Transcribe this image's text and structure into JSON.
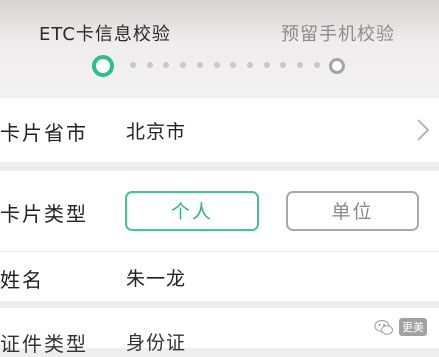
{
  "steps": {
    "step1_label": "ETC卡信息校验",
    "step2_label": "预留手机校验"
  },
  "form": {
    "province": {
      "label": "卡片省市",
      "value": "北京市"
    },
    "card_type": {
      "label": "卡片类型",
      "options": [
        "个人",
        "单位"
      ],
      "selected": "个人"
    },
    "name": {
      "label": "姓名",
      "value": "朱一龙"
    },
    "id_type": {
      "label": "证件类型",
      "value": "身份证"
    }
  },
  "watermark": {
    "text": "更美",
    "icon": "wechat-icon"
  },
  "colors": {
    "accent": "#2bbf8a",
    "inactive": "#a4a4a4",
    "background": "#efeeee"
  }
}
